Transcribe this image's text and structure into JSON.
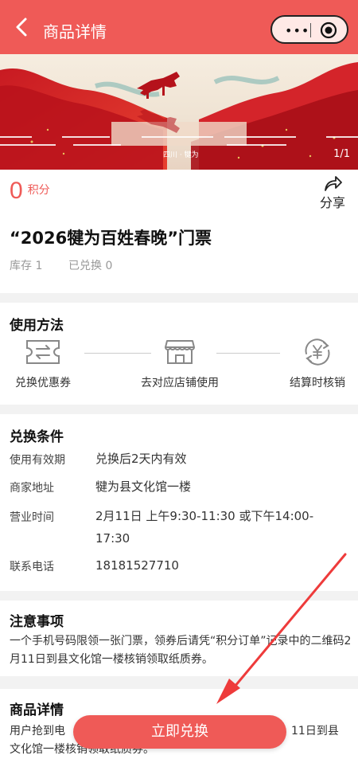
{
  "header": {
    "title": "商品详情",
    "back_icon": "chevron-left-icon",
    "more_icon": "more-dots-icon",
    "close_icon": "record-icon",
    "bg": "#ef5a57"
  },
  "banner": {
    "counter": "1/1",
    "location_text": "四川 · 犍为"
  },
  "product": {
    "points_value": "0",
    "points_unit": "积分",
    "share_label": "分享",
    "title": "“2026犍为百姓春晚”门票",
    "stock": "库存 1",
    "exchanged": "已兑换 0"
  },
  "usage": {
    "title": "使用方法",
    "steps": [
      {
        "label": "兑换优惠券",
        "icon": "coupon-icon"
      },
      {
        "label": "去对应店铺使用",
        "icon": "store-icon"
      },
      {
        "label": "结算时核销",
        "icon": "yuan-refresh-icon"
      }
    ]
  },
  "conditions": {
    "title": "兑换条件",
    "rows": [
      {
        "label": "使用有效期",
        "value": "兑换后2天内有效"
      },
      {
        "label": "商家地址",
        "value": "犍为县文化馆一楼"
      },
      {
        "label": "营业时间",
        "value": "2月11日 上午9:30-11:30 或下午14:00-17:30"
      },
      {
        "label": "联系电话",
        "value": "18181527710"
      }
    ]
  },
  "notes": {
    "title": "注意事项",
    "text": "一个手机号码限领一张门票，领券后请凭“积分订单”记录中的二维码2月11日到县文化馆一楼核销领取纸质券。"
  },
  "details": {
    "title": "商品详情",
    "text_left": "用户抢到电",
    "text_right": "11日到县",
    "text_line2": "文化馆一楼核销领取纸质券。"
  },
  "cta": {
    "label": "立即兑换"
  },
  "colors": {
    "accent": "#ef5a57",
    "annotation": "#ee3b3b"
  }
}
